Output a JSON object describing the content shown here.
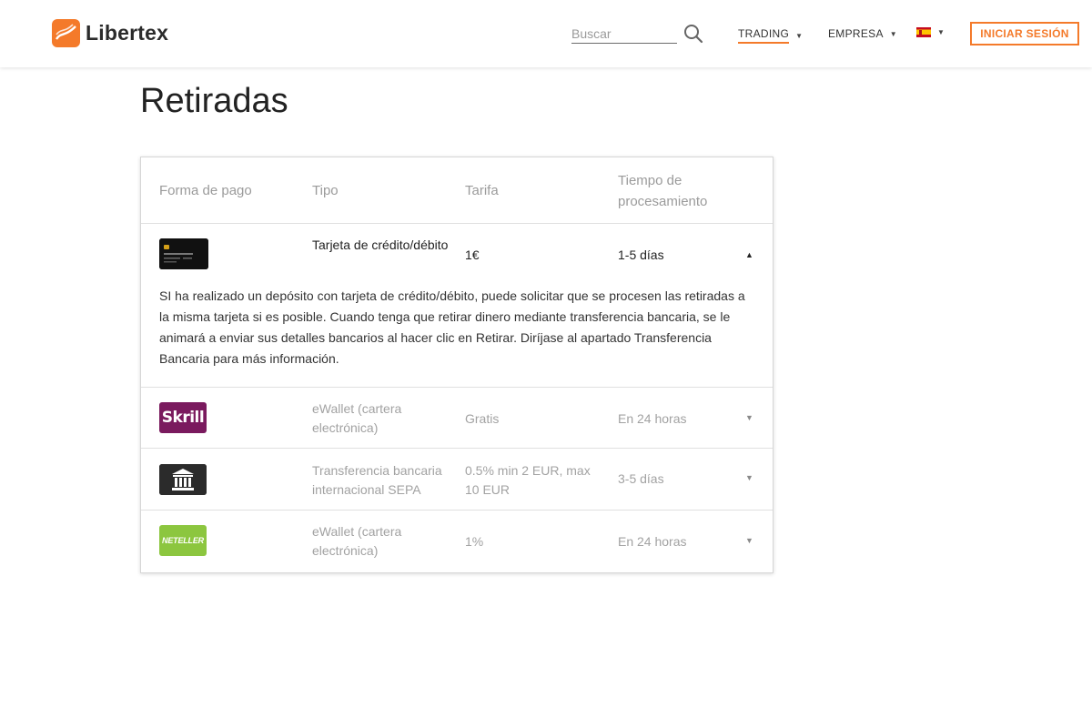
{
  "header": {
    "brand": "Libertex",
    "search_placeholder": "Buscar",
    "nav": [
      {
        "label": "TRADING"
      },
      {
        "label": "EMPRESA"
      }
    ],
    "login_label": "INICIAR SESIÓN",
    "accent_color": "#f47a2a"
  },
  "page": {
    "title": "Retiradas"
  },
  "table": {
    "headers": [
      "Forma de pago",
      "Tipo",
      "Tarifa",
      "Tiempo de procesamiento"
    ],
    "rows": [
      {
        "icon": "credit-card-icon",
        "type": "Tarjeta de crédito/débito",
        "fee": "1€",
        "time": "1-5 días",
        "expanded": true,
        "detail": "SI ha realizado un depósito con tarjeta de crédito/débito, puede solicitar que se procesen las retiradas a la misma tarjeta si es posible. Cuando tenga que retirar dinero mediante transferencia bancaria, se le animará a enviar sus detalles bancarios al hacer clic en Retirar. Diríjase al apartado Transferencia Bancaria para más información."
      },
      {
        "icon": "skrill-logo-icon",
        "icon_text": "Skrill",
        "type": "eWallet (cartera electrónica)",
        "fee": "Gratis",
        "time": "En 24 horas",
        "expanded": false
      },
      {
        "icon": "bank-icon",
        "type": "Transferencia bancaria internacional SEPA",
        "fee": "0.5% min 2 EUR, max 10 EUR",
        "time": "3-5 días",
        "expanded": false
      },
      {
        "icon": "neteller-logo-icon",
        "icon_text": "NETELLER",
        "type": "eWallet (cartera electrónica)",
        "fee": "1%",
        "time": "En 24 horas",
        "expanded": false
      }
    ]
  }
}
